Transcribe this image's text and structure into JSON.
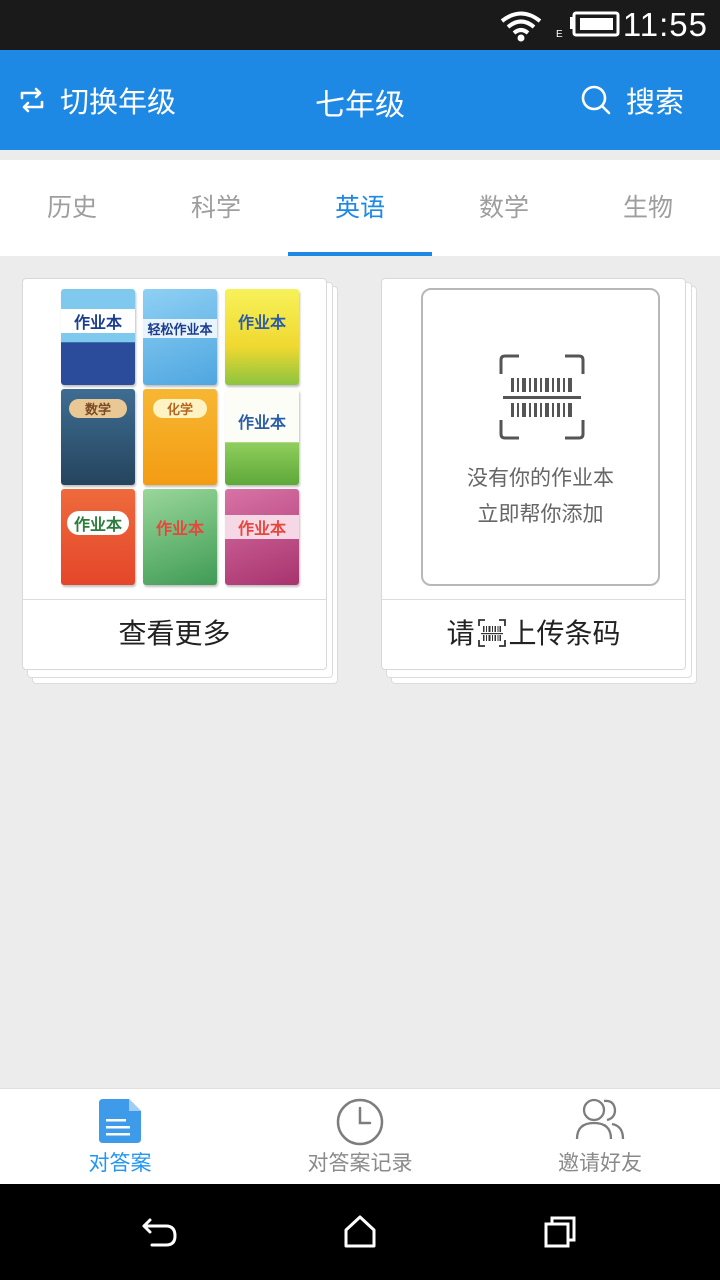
{
  "status_bar": {
    "time": "11:55",
    "icons": [
      "wifi-icon",
      "battery-icon"
    ]
  },
  "header": {
    "switch_label": "切换年级",
    "title": "七年级",
    "search_label": "搜索",
    "color": "#1e88e5"
  },
  "tabs": [
    {
      "label": "历史",
      "active": false
    },
    {
      "label": "科学",
      "active": false
    },
    {
      "label": "英语",
      "active": true
    },
    {
      "label": "数学",
      "active": false
    },
    {
      "label": "生物",
      "active": false
    }
  ],
  "cards": {
    "more": {
      "footer_label": "查看更多",
      "books": [
        "作业本",
        "轻松作业本",
        "作业本",
        "数学",
        "化学",
        "作业本",
        "作业本",
        "作业本",
        "作业本"
      ]
    },
    "upload": {
      "hint_line1": "没有你的作业本",
      "hint_line2": "立即帮你添加",
      "footer_prefix": "请",
      "footer_suffix": "上传条码"
    }
  },
  "bottom_nav": [
    {
      "label": "对答案",
      "icon": "document-icon",
      "active": true
    },
    {
      "label": "对答案记录",
      "icon": "clock-icon",
      "active": false
    },
    {
      "label": "邀请好友",
      "icon": "friends-icon",
      "active": false
    }
  ],
  "system_nav": [
    "back-icon",
    "home-icon",
    "recents-icon"
  ]
}
